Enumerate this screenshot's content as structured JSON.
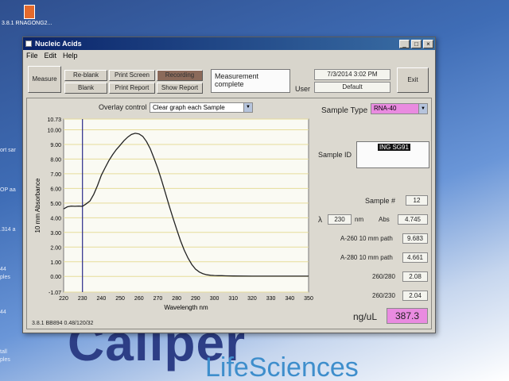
{
  "desktop": {
    "top_label": "3.8.1 RNAGONG2...",
    "side_labels": [
      "ort   sar",
      "OP   aa",
      ".314   a",
      "44",
      "ples",
      "44",
      "tall",
      "ples"
    ],
    "brand_big": "Caliper",
    "brand_sub": "LifeSciences"
  },
  "window": {
    "title": "Nucleic Acids",
    "minimize": "_",
    "maximize": "□",
    "close": "×"
  },
  "menu": {
    "file": "File",
    "edit": "Edit",
    "help": "Help"
  },
  "toolbar": {
    "measure": "Measure",
    "reblank": "Re-blank",
    "blank": "Blank",
    "print_screen": "Print Screen",
    "print_report": "Print Report",
    "recording": "Recording",
    "show_report": "Show Report",
    "status": "Measurement complete",
    "datetime": "7/3/2014  3:02 PM",
    "user_label": "User",
    "user_value": "Default",
    "exit": "Exit"
  },
  "overlay": {
    "label": "Overlay control",
    "value": "Clear graph each Sample"
  },
  "sample": {
    "type_label": "Sample Type",
    "type_value": "RNA-40",
    "id_label": "Sample ID",
    "id_value": "ING SG91",
    "number_label": "Sample #",
    "number_value": "12",
    "lambda_symbol": "λ",
    "lambda_value": "230",
    "lambda_unit": "nm",
    "abs_label": "Abs",
    "abs_value": "4.745",
    "a260_label": "A-260 10 mm path",
    "a260_value": "9.683",
    "a280_label": "A-280 10 mm path",
    "a280_value": "4.661",
    "r260280_label": "260/280",
    "r260280_value": "2.08",
    "r260230_label": "260/230",
    "r260230_value": "2.04",
    "conc_label": "ng/uL",
    "conc_value": "387.3"
  },
  "footer": {
    "version": "3.8.1 BB894 0.48/120/32"
  },
  "colors": {
    "pink": "#e98be0",
    "graph_bg": "#fafaf3",
    "grid": "#e6dc9a",
    "curve": "#222222",
    "marker": "#2a2a8a"
  },
  "chart_data": {
    "type": "line",
    "xlabel": "Wavelength nm",
    "ylabel": "10 mm Absorbance",
    "xlim": [
      220,
      350
    ],
    "ylim": [
      -1.07,
      10.73
    ],
    "x_ticks": [
      220,
      230,
      240,
      250,
      260,
      270,
      280,
      290,
      300,
      310,
      320,
      330,
      340,
      350
    ],
    "y_ticks": [
      -1.07,
      0.0,
      1.0,
      2.0,
      3.0,
      4.0,
      5.0,
      6.0,
      7.0,
      8.0,
      9.0,
      10.0,
      10.73
    ],
    "y_tick_labels": [
      "-1.07",
      "0.00",
      "1.00",
      "2.00",
      "3.00",
      "4.00",
      "5.00",
      "6.00",
      "7.00",
      "8.00",
      "9.00",
      "10.00",
      "10.73"
    ],
    "marker_x": 230,
    "series": [
      {
        "x": [
          220,
          222,
          224,
          226,
          228,
          230,
          232,
          234,
          236,
          238,
          240,
          242,
          244,
          246,
          248,
          250,
          252,
          254,
          256,
          258,
          260,
          262,
          264,
          266,
          268,
          270,
          272,
          274,
          276,
          278,
          280,
          282,
          284,
          286,
          288,
          290,
          292,
          294,
          296,
          298,
          300,
          302,
          304,
          306,
          310,
          320,
          330,
          340,
          350
        ],
        "y": [
          4.6,
          4.75,
          4.8,
          4.78,
          4.8,
          4.78,
          4.95,
          5.15,
          5.6,
          6.2,
          6.9,
          7.4,
          7.9,
          8.3,
          8.65,
          8.95,
          9.25,
          9.5,
          9.68,
          9.76,
          9.72,
          9.55,
          9.2,
          8.7,
          8.05,
          7.35,
          6.55,
          5.7,
          4.82,
          4.0,
          3.2,
          2.45,
          1.8,
          1.25,
          0.82,
          0.5,
          0.3,
          0.18,
          0.11,
          0.08,
          0.06,
          0.05,
          0.05,
          0.04,
          0.03,
          0.02,
          0.02,
          0.02,
          0.02
        ]
      }
    ]
  }
}
